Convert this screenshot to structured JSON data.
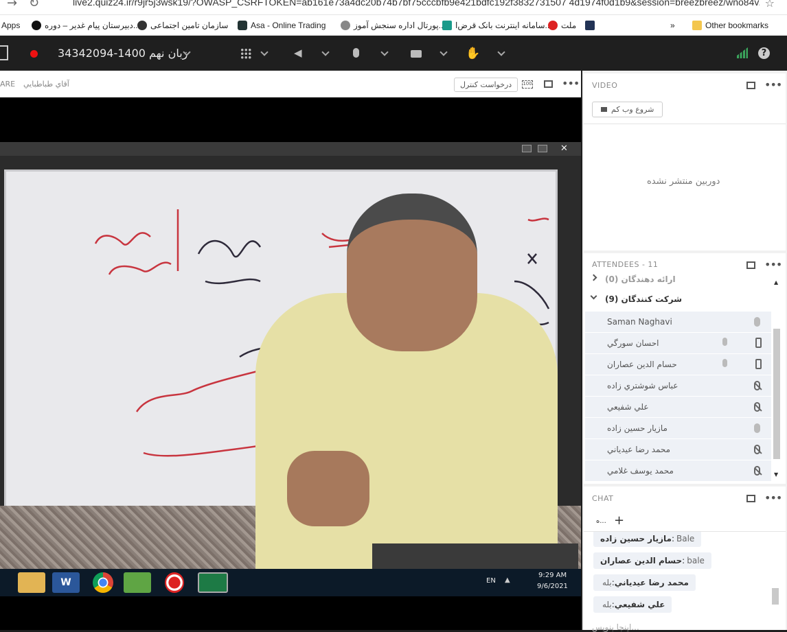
{
  "browser": {
    "url": "live2.quiz24.ir/r9jr5j3wsk19/?OWASP_CSRFTOKEN=ab161e73a4dc20b74b7bf75cccbfb9e421bdfc192f3832731507 4d1974f0d1b9&session=breezbreez/wno84v...",
    "bookmarks": [
      "Apps",
      "دبیرستان پیام غدیر – دوره...",
      "سازمان تامین اجتماعی",
      "Asa - Online Trading",
      "پورتال اداره سنجش آموز...",
      "سامانه اینترنت بانک قرض‌ا...",
      "ملت"
    ],
    "other_bookmarks": "Other bookmarks",
    "more": "»"
  },
  "meeting": {
    "title": "زبان نهم 1400-34342094",
    "presenter": "آقاي طباطبايي",
    "share_label": "ARE",
    "request_control": "درخواست كنترل"
  },
  "video_panel": {
    "title": "VIDEO",
    "start_webcam": "شروع وب كم",
    "no_camera": "دوربين منتشر نشده"
  },
  "attendees": {
    "title": "ATTENDEES",
    "count": "11",
    "hosts_group": "ارائه دهندگان (0)",
    "participants_group": "شركت كنندگان (9)",
    "list": [
      {
        "name": "Saman Naghavi",
        "mic": "on",
        "phone": false
      },
      {
        "name": "احسان سورگي",
        "mic": "on",
        "phone": true
      },
      {
        "name": "حسام الدين عصاران",
        "mic": "on",
        "phone": true
      },
      {
        "name": "عباس شوشتري زاده",
        "mic": "muted",
        "phone": false
      },
      {
        "name": "علي شفيعي",
        "mic": "muted",
        "phone": false
      },
      {
        "name": "مازيار حسين زاده",
        "mic": "on",
        "phone": false
      },
      {
        "name": "محمد رضا عيدياني",
        "mic": "muted",
        "phone": false
      },
      {
        "name": "محمد يوسف غلامي",
        "mic": "muted",
        "phone": false
      }
    ]
  },
  "chat": {
    "title": "CHAT",
    "tab": "ه...",
    "messages": [
      {
        "sender": "مازيار حسين زاده",
        "text": "Bale"
      },
      {
        "sender": "حسام الدين عصاران",
        "text": "bale"
      },
      {
        "sender": "محمد رضا عيدياني",
        "text": "بله"
      },
      {
        "sender": "علي شفيعي",
        "text": "بله"
      }
    ],
    "input_placeholder": "اينجا بنويس..."
  },
  "taskbar": {
    "lang": "EN",
    "time": "9:29 AM",
    "date": "9/6/2021"
  }
}
